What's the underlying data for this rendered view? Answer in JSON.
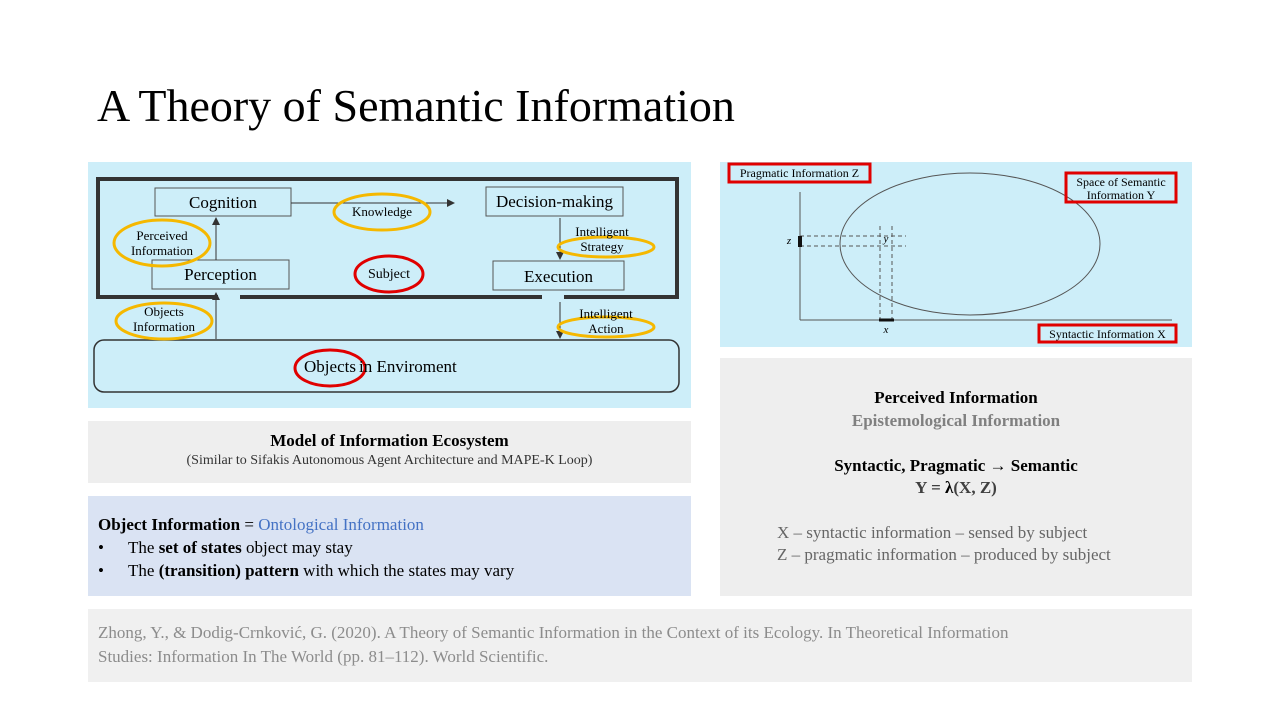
{
  "slide": {
    "title": "A Theory of Semantic Information"
  },
  "left_diagram": {
    "cognition": "Cognition",
    "knowledge": "Knowledge",
    "decision": "Decision-making",
    "perceived_1": "Perceived",
    "perceived_2": "Information",
    "strategy_1": "Intelligent",
    "strategy_2": "Strategy",
    "perception": "Perception",
    "subject": "Subject",
    "execution": "Execution",
    "objects_info_1": "Objects",
    "objects_info_2": "Information",
    "action_1": "Intelligent",
    "action_2": "Action",
    "objects": "Objects",
    "environment": "in Enviroment"
  },
  "model_caption": {
    "title": "Model of Information Ecosystem",
    "subtitle": "(Similar to Sifakis Autonomous Agent Architecture and MAPE-K Loop)"
  },
  "object_info": {
    "heading_bold": "Object Information",
    "equals": " = ",
    "heading_link": "Ontological Information",
    "bullet1_pre": "The ",
    "bullet1_bold": "set of states",
    "bullet1_post": " object may stay",
    "bullet2_pre": "The ",
    "bullet2_bold": "(transition) pattern",
    "bullet2_post": " with which the states may vary",
    "bullet_char": "•"
  },
  "right_diagram": {
    "pragmatic_label": "Pragmatic Information Z",
    "semantic_label_1": "Space of Semantic",
    "semantic_label_2": "Information Y",
    "syntactic_label": "Syntactic Information X",
    "z_tick": "z",
    "y_tick": "y",
    "x_tick": "x"
  },
  "perceived_panel": {
    "title": "Perceived Information",
    "subtitle": "Epistemological Information",
    "relation": "Syntactic, Pragmatic → Semantic",
    "formula_pre": "Y = ",
    "formula_lambda": "λ",
    "formula_post": "(X, Z)",
    "x_def": "X – syntactic information – sensed by subject",
    "z_def": "Z – pragmatic information – produced by subject"
  },
  "reference": {
    "line1": "Zhong, Y., & Dodig-Crnković, G. (2020). A Theory of Semantic Information in the Context of its Ecology. In Theoretical Information",
    "line2": "Studies: Information In The World (pp. 81–112). World Scientific."
  },
  "colors": {
    "panel_blue": "#cdeef9",
    "caption_gray": "#eeeeee",
    "object_box": "#dae3f3",
    "link_blue": "#4472c4",
    "highlight_yellow": "#f5b800",
    "highlight_red": "#e00000",
    "muted_text": "#808080"
  }
}
